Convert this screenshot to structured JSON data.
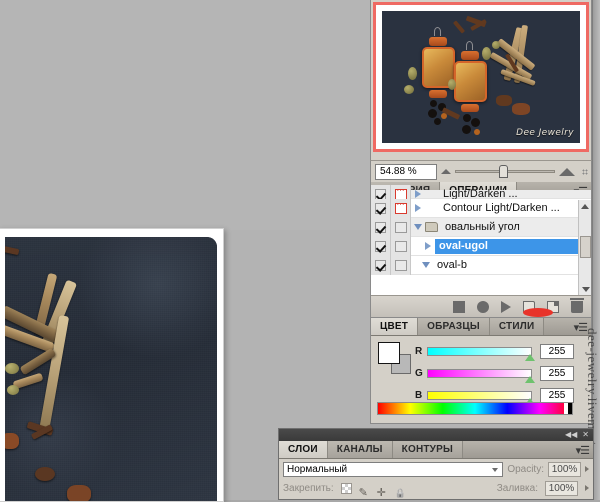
{
  "app": {
    "background_color": "#b3b3b3",
    "accent_selected": "#3d95e8",
    "highlight_red": "#e8332a"
  },
  "navigator": {
    "panel_name": "Navigator preview",
    "frame_color": "#ef6a63",
    "thumbnail_watermark": "Dee Jewelry",
    "zoom_value": "54.88 %",
    "zoom_out_icon": "small-mountain-icon",
    "zoom_in_icon": "large-mountain-icon"
  },
  "actions_panel": {
    "tabs": [
      {
        "label": "ИСТОРИЯ",
        "active": false
      },
      {
        "label": "ОПЕРАЦИИ",
        "active": true
      }
    ],
    "menu_icon": "panel-menu-icon",
    "rows": [
      {
        "label": "Light/Darken ...",
        "checked": true,
        "dialog": true,
        "kind": "action",
        "indent": 2,
        "selected": false,
        "clipped": true
      },
      {
        "label": "Contour Light/Darken ...",
        "checked": true,
        "dialog": true,
        "kind": "action",
        "indent": 2,
        "selected": false,
        "clipped": false
      },
      {
        "label": "овальный угол",
        "checked": true,
        "dialog": false,
        "kind": "folder-open",
        "indent": 0,
        "selected": false,
        "clipped": false
      },
      {
        "label": "oval-ugol",
        "checked": true,
        "dialog": false,
        "kind": "action",
        "indent": 2,
        "selected": true,
        "clipped": false
      },
      {
        "label": "oval-b",
        "checked": true,
        "dialog": false,
        "kind": "action-open",
        "indent": 1,
        "selected": false,
        "clipped": false
      }
    ],
    "footer_buttons": [
      {
        "name": "stop-button",
        "icon": "stop-icon"
      },
      {
        "name": "record-button",
        "icon": "record-icon"
      },
      {
        "name": "play-button",
        "icon": "play-icon"
      },
      {
        "name": "new-set-button",
        "icon": "folder-icon"
      },
      {
        "name": "new-action-button",
        "icon": "new-page-icon"
      },
      {
        "name": "delete-button",
        "icon": "trash-icon"
      }
    ],
    "highlight_on": "new-action-button"
  },
  "color_panel": {
    "tabs": [
      {
        "label": "ЦВЕТ",
        "active": true
      },
      {
        "label": "ОБРАЗЦЫ",
        "active": false
      },
      {
        "label": "СТИЛИ",
        "active": false
      }
    ],
    "menu_icon": "panel-menu-icon",
    "foreground_color": "#ffffff",
    "background_color": "#b8b8b8",
    "channels": [
      {
        "label": "R",
        "value": "255"
      },
      {
        "label": "G",
        "value": "255"
      },
      {
        "label": "B",
        "value": "255"
      }
    ],
    "spectrum_name": "color-spectrum-ramp"
  },
  "layers_panel": {
    "tabs": [
      {
        "label": "СЛОИ",
        "active": true
      },
      {
        "label": "КАНАЛЫ",
        "active": false
      },
      {
        "label": "КОНТУРЫ",
        "active": false
      }
    ],
    "menu_icon": "panel-menu-icon",
    "collapse_icon": "collapse-dock-icon",
    "close_icon": "close-icon",
    "blend_mode": "Нормальный",
    "opacity_label": "Opacity:",
    "opacity_value": "100%",
    "lock_label": "Закрепить:",
    "fill_label": "Заливка:",
    "fill_value": "100%",
    "lock_icons": [
      "lock-transparency-icon",
      "lock-image-icon",
      "lock-position-icon",
      "lock-all-icon"
    ]
  },
  "watermark": {
    "side_text": "dee-jewelry.livemaster.ru"
  },
  "document_window": {
    "name": "photo-canvas",
    "description": "Dark fabric photograph with cinnamon sticks and star anise"
  }
}
